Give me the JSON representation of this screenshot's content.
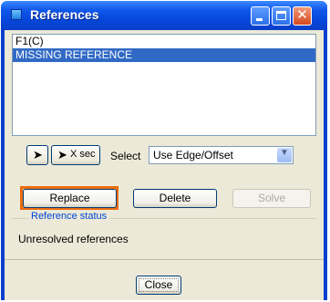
{
  "window": {
    "title": "References"
  },
  "title_buttons": {
    "minimize": "minimize",
    "maximize": "maximize",
    "close_glyph": "✕"
  },
  "references_list": [
    "F1(C)",
    "MISSING REFERENCE"
  ],
  "selected_index": 1,
  "toolbar": {
    "pick_icon": "arrow-cursor-icon",
    "xsec_label": "X sec",
    "select_label": "Select",
    "select_value": "Use Edge/Offset"
  },
  "actions": {
    "replace": "Replace",
    "delete": "Delete",
    "solve": "Solve"
  },
  "status": {
    "group_label": "Reference status",
    "text": "Unresolved references"
  },
  "footer": {
    "close": "Close"
  },
  "colors": {
    "highlight": "#ec6d0f",
    "selection": "#316ac5"
  }
}
